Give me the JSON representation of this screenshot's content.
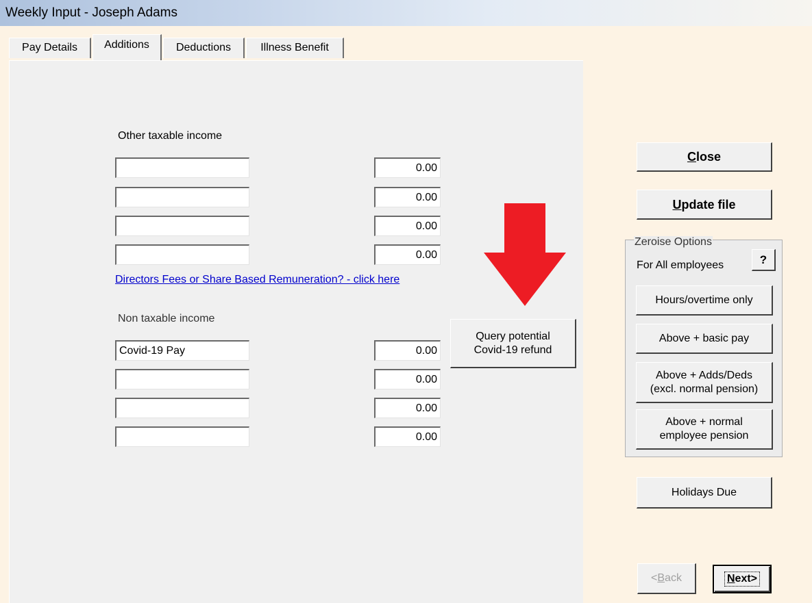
{
  "window": {
    "title": "Weekly Input - Joseph Adams"
  },
  "tabs": [
    {
      "label": "Pay Details",
      "active": false
    },
    {
      "label": "Additions",
      "active": true
    },
    {
      "label": "Deductions",
      "active": false
    },
    {
      "label": "Illness Benefit",
      "active": false
    }
  ],
  "taxable": {
    "heading": "Other taxable income",
    "rows": [
      {
        "description": "",
        "amount": "0.00"
      },
      {
        "description": "",
        "amount": "0.00"
      },
      {
        "description": "",
        "amount": "0.00"
      },
      {
        "description": "",
        "amount": "0.00"
      }
    ]
  },
  "directors_link": "Directors Fees or Share Based Remuneration? - click here",
  "nontaxable": {
    "heading": "Non taxable income",
    "rows": [
      {
        "description": "Covid-19 Pay",
        "amount": "0.00"
      },
      {
        "description": "",
        "amount": "0.00"
      },
      {
        "description": "",
        "amount": "0.00"
      },
      {
        "description": "",
        "amount": "0.00"
      }
    ]
  },
  "query_button": {
    "line1": "Query potential",
    "line2": "Covid-19 refund"
  },
  "annotation": {
    "icon": "red-down-arrow",
    "color": "#ed1c24"
  },
  "actions": {
    "close": {
      "mnemonic": "C",
      "rest": "lose"
    },
    "update": {
      "mnemonic": "U",
      "rest": "pdate file"
    }
  },
  "zeroise": {
    "legend": "Zeroise Options",
    "subtitle": "For All employees",
    "help_label": "?",
    "options": [
      {
        "line1": "Hours/overtime only",
        "line2": ""
      },
      {
        "line1": "Above + basic pay",
        "line2": ""
      },
      {
        "line1": "Above + Adds/Deds",
        "line2": "(excl. normal pension)"
      },
      {
        "line1": "Above + normal",
        "line2": "employee pension"
      }
    ]
  },
  "holidays_label": "Holidays Due",
  "nav": {
    "back": {
      "prefix": "<",
      "mnemonic": "B",
      "rest": "ack",
      "enabled": false
    },
    "next": {
      "mnemonic": "N",
      "rest": "ext>",
      "enabled": true
    }
  }
}
